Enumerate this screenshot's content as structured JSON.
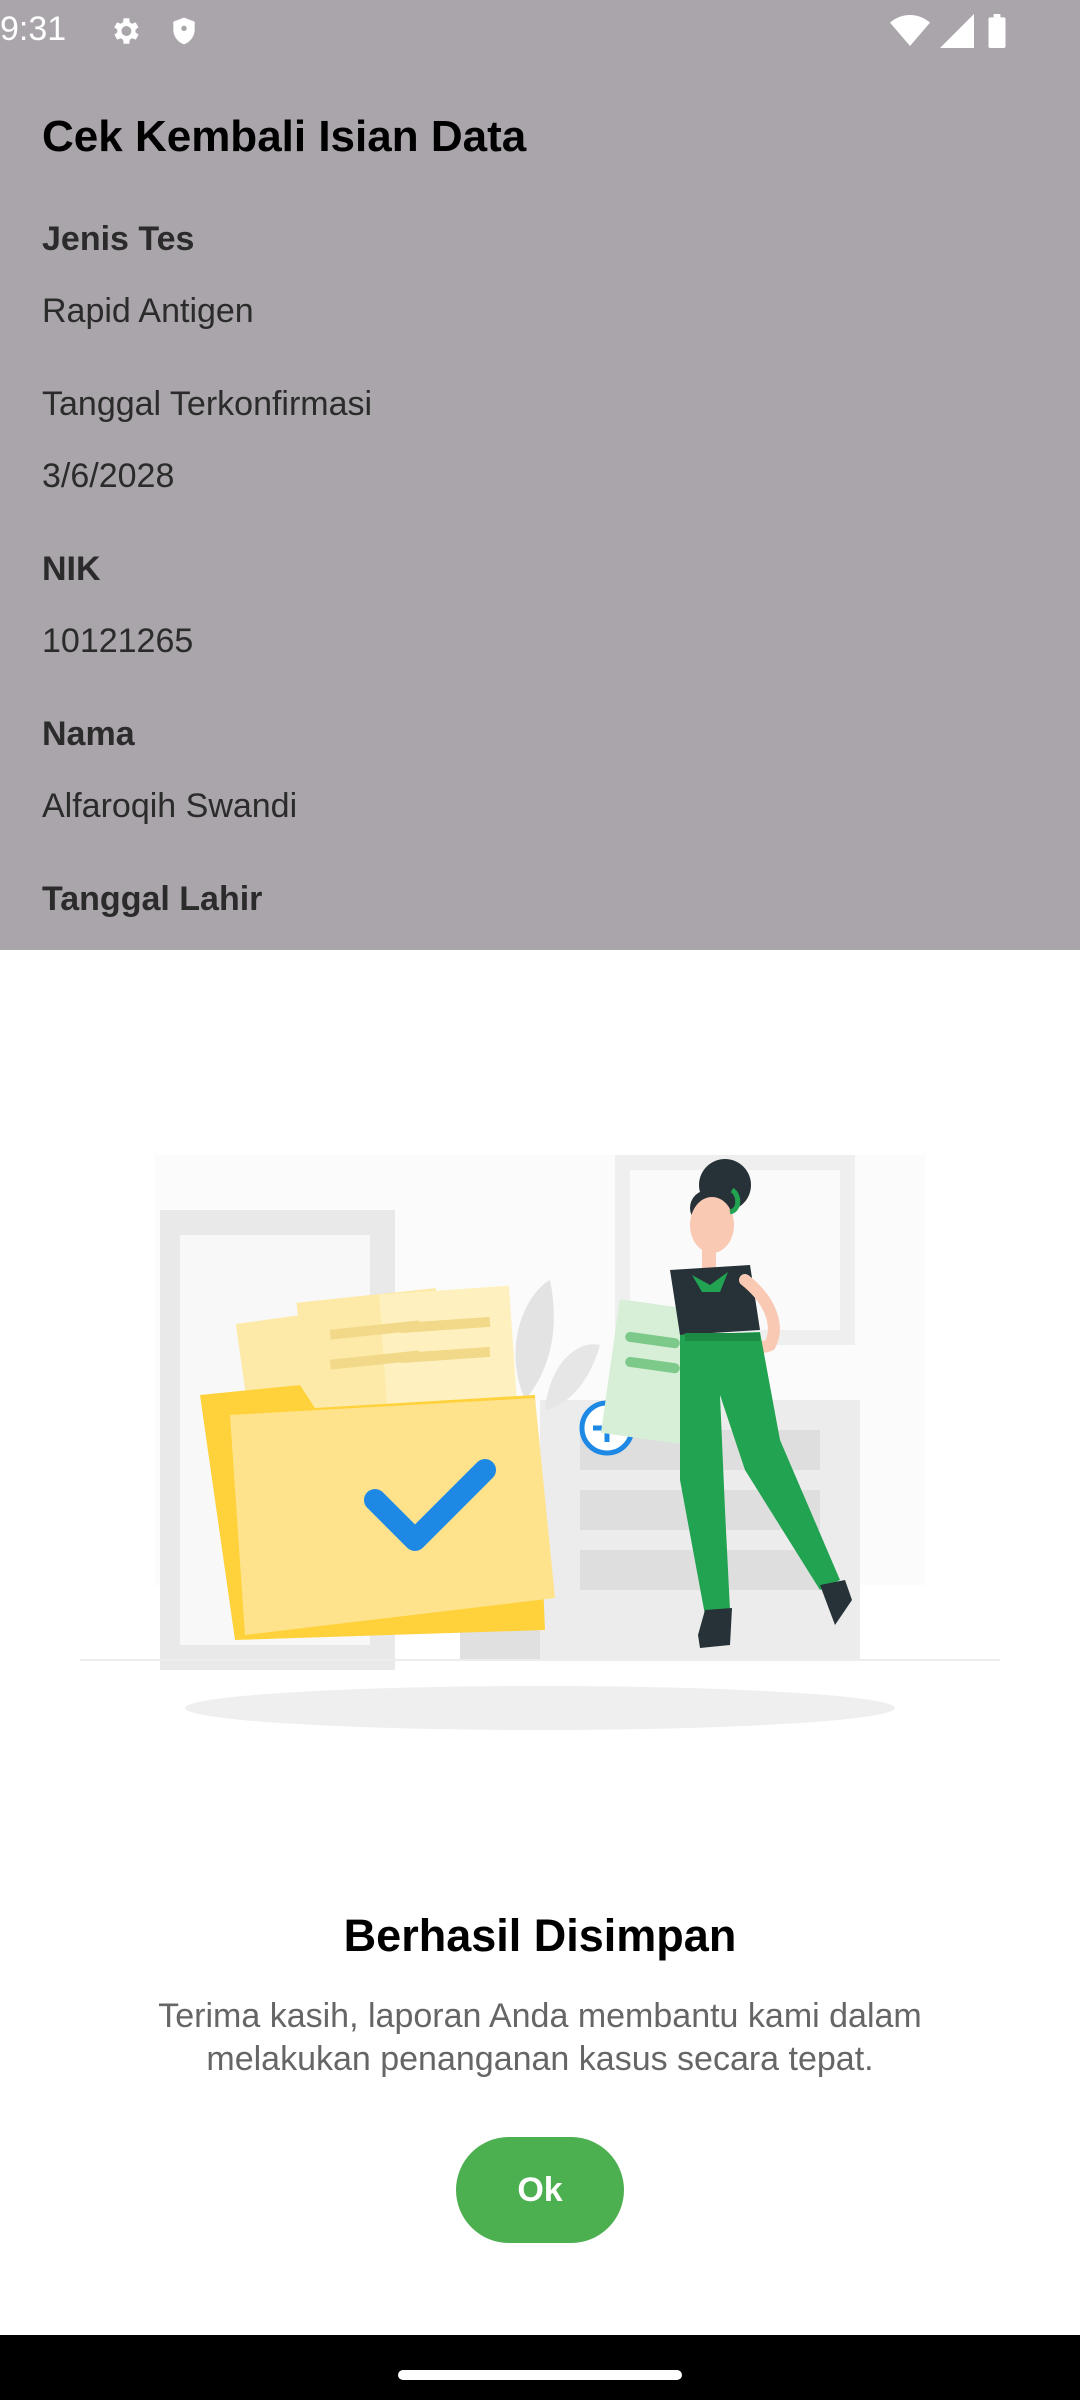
{
  "status_bar": {
    "time": "9:31"
  },
  "page": {
    "title": "Cek Kembali Isian Data",
    "fields": [
      {
        "label": "Jenis Tes",
        "value": "Rapid Antigen"
      },
      {
        "label": "Tanggal Terkonfirmasi",
        "value": "3/6/2028"
      },
      {
        "label": "NIK",
        "value": "10121265"
      },
      {
        "label": "Nama",
        "value": "Alfaroqih Swandi"
      },
      {
        "label": "Tanggal Lahir",
        "value": ""
      }
    ]
  },
  "dialog": {
    "title": "Berhasil Disimpan",
    "message": "Terima kasih, laporan Anda membantu kami dalam melakukan penanganan kasus secara tepat.",
    "ok_label": "Ok"
  },
  "colors": {
    "accent": "#4caf50",
    "scrim": "#a9a5aa",
    "folder": "#ffe38c",
    "check": "#1e88e5"
  }
}
